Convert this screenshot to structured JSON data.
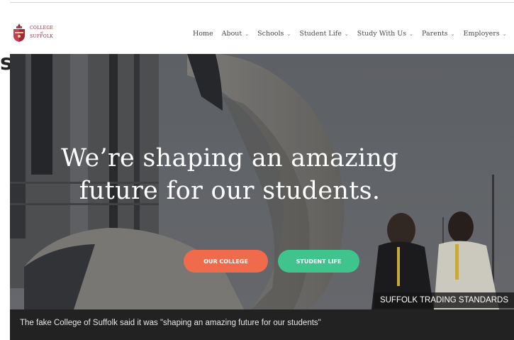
{
  "header": {
    "logo": {
      "line1": "COLLEGE",
      "line2": "of",
      "line3": "SUFFOLK"
    },
    "nav": [
      {
        "label": "Home",
        "has_dropdown": false
      },
      {
        "label": "About",
        "has_dropdown": true
      },
      {
        "label": "Schools",
        "has_dropdown": true
      },
      {
        "label": "Student Life",
        "has_dropdown": true
      },
      {
        "label": "Study With Us",
        "has_dropdown": true
      },
      {
        "label": "Parents",
        "has_dropdown": true
      },
      {
        "label": "Employers",
        "has_dropdown": true
      }
    ],
    "dropdown_glyph": "⌄"
  },
  "page_edge_text": "s",
  "hero": {
    "title_line1": "We’re shaping an amazing",
    "title_line2": "future for our students.",
    "buttons": {
      "college_label": "OUR COLLEGE",
      "life_label": "STUDENT LIFE"
    },
    "credit": "SUFFOLK TRADING STANDARDS"
  },
  "caption": "The fake College of Suffolk said it was \"shaping an amazing future for our students\"",
  "colors": {
    "brand": "#8a2b3a",
    "button_college": "#ef6b4c",
    "button_life": "#3ec48c",
    "caption_bg": "#222222"
  }
}
